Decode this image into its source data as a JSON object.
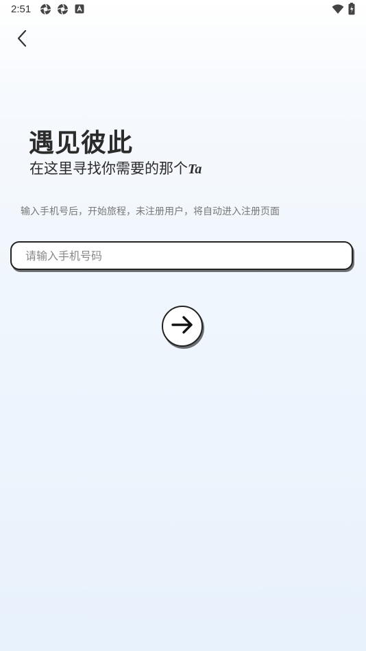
{
  "status_bar": {
    "time": "2:51",
    "icons": [
      "aperture-icon",
      "aperture-icon",
      "a-box-icon",
      "wifi-icon",
      "battery-charging-icon"
    ]
  },
  "nav": {
    "back_icon": "chevron-left-icon"
  },
  "hero": {
    "title": "遇见彼此",
    "subtitle": "在这里寻找你需要的那个",
    "subtitle_suffix": "Ta"
  },
  "hint": "输入手机号后，开始旅程，未注册用户，将自动进入注册页面",
  "phone_input": {
    "placeholder": "请输入手机号码",
    "value": ""
  },
  "next_button": {
    "icon": "arrow-right-icon"
  },
  "colors": {
    "text": "#2b2b2b",
    "hint": "#777777",
    "border": "#222222",
    "background_top": "#ffffff",
    "background_bottom": "#e8f2fc"
  }
}
